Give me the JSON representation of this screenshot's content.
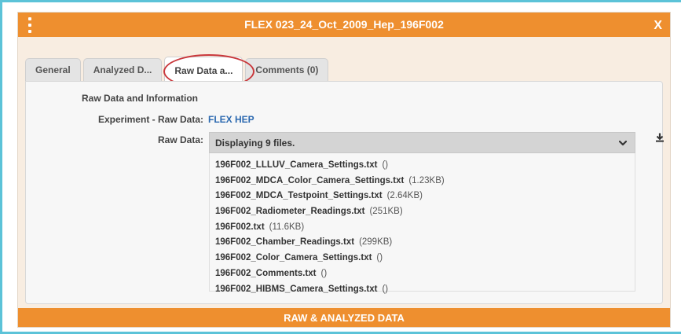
{
  "dialog": {
    "title": "FLEX 023_24_Oct_2009_Hep_196F002",
    "close_label": "X",
    "menu_icon": "vertical-dots-icon"
  },
  "tabs": [
    {
      "label": "General",
      "active": false
    },
    {
      "label": "Analyzed D...",
      "active": false
    },
    {
      "label": "Raw Data a...",
      "active": true
    },
    {
      "label": "Comments (0)",
      "active": false
    }
  ],
  "panel": {
    "heading": "Raw Data and Information",
    "experiment_label": "Experiment - Raw Data:",
    "experiment_value": "FLEX HEP",
    "raw_data_label": "Raw Data:",
    "dropdown_text": "Displaying 9 files.",
    "files": [
      {
        "name": "196F002_LLLUV_Camera_Settings.txt",
        "size": "()"
      },
      {
        "name": "196F002_MDCA_Color_Camera_Settings.txt",
        "size": "(1.23KB)"
      },
      {
        "name": "196F002_MDCA_Testpoint_Settings.txt",
        "size": "(2.64KB)"
      },
      {
        "name": "196F002_Radiometer_Readings.txt",
        "size": "(251KB)"
      },
      {
        "name": "196F002.txt",
        "size": "(11.6KB)"
      },
      {
        "name": "196F002_Chamber_Readings.txt",
        "size": "(299KB)"
      },
      {
        "name": "196F002_Color_Camera_Settings.txt",
        "size": "()"
      },
      {
        "name": "196F002_Comments.txt",
        "size": "()"
      },
      {
        "name": "196F002_HIBMS_Camera_Settings.txt",
        "size": "()"
      }
    ]
  },
  "footer": {
    "label": "RAW & ANALYZED DATA"
  },
  "colors": {
    "accent": "#ee8f2f",
    "link": "#2c69b0",
    "highlight_circle": "#c9373b",
    "frame_border": "#5cc3d8"
  }
}
